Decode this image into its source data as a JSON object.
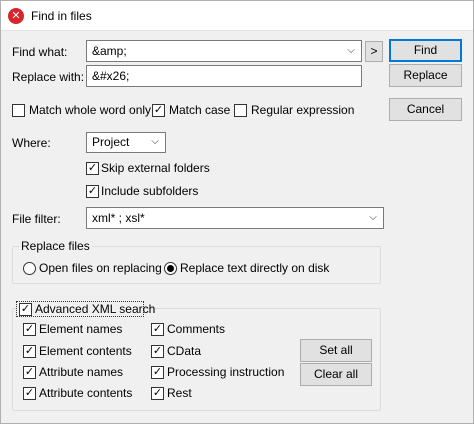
{
  "window": {
    "title": "Find in files",
    "icon": "app-x-icon"
  },
  "find": {
    "label": "Find what:",
    "value": "&amp;",
    "history_button": ">"
  },
  "replace": {
    "label": "Replace with:",
    "value": "&#x26;"
  },
  "buttons": {
    "find": "Find",
    "replace": "Replace",
    "cancel": "Cancel",
    "set_all": "Set all",
    "clear_all": "Clear all"
  },
  "options": {
    "whole_word": {
      "label": "Match whole word only",
      "checked": false
    },
    "match_case": {
      "label": "Match case",
      "checked": true
    },
    "regex": {
      "label": "Regular expression",
      "checked": false
    }
  },
  "where": {
    "label": "Where:",
    "value": "Project",
    "skip_external": {
      "label": "Skip external folders",
      "checked": true
    },
    "include_sub": {
      "label": "Include subfolders",
      "checked": true
    }
  },
  "file_filter": {
    "label": "File filter:",
    "value": "xml* ; xsl*"
  },
  "replace_files": {
    "title": "Replace files",
    "open_on_replace": "Open files on replacing",
    "replace_on_disk": "Replace text directly on disk",
    "selected": "replace_on_disk"
  },
  "advanced": {
    "title": "Advanced XML search",
    "checked": true,
    "items": [
      {
        "label": "Element names",
        "checked": true
      },
      {
        "label": "Element contents",
        "checked": true
      },
      {
        "label": "Attribute names",
        "checked": true
      },
      {
        "label": "Attribute contents",
        "checked": true
      },
      {
        "label": "Comments",
        "checked": true
      },
      {
        "label": "CData",
        "checked": true
      },
      {
        "label": "Processing instruction",
        "checked": true
      },
      {
        "label": "Rest",
        "checked": true
      }
    ]
  },
  "colors": {
    "accent": "#0078d7",
    "app_icon": "#d9252a"
  }
}
